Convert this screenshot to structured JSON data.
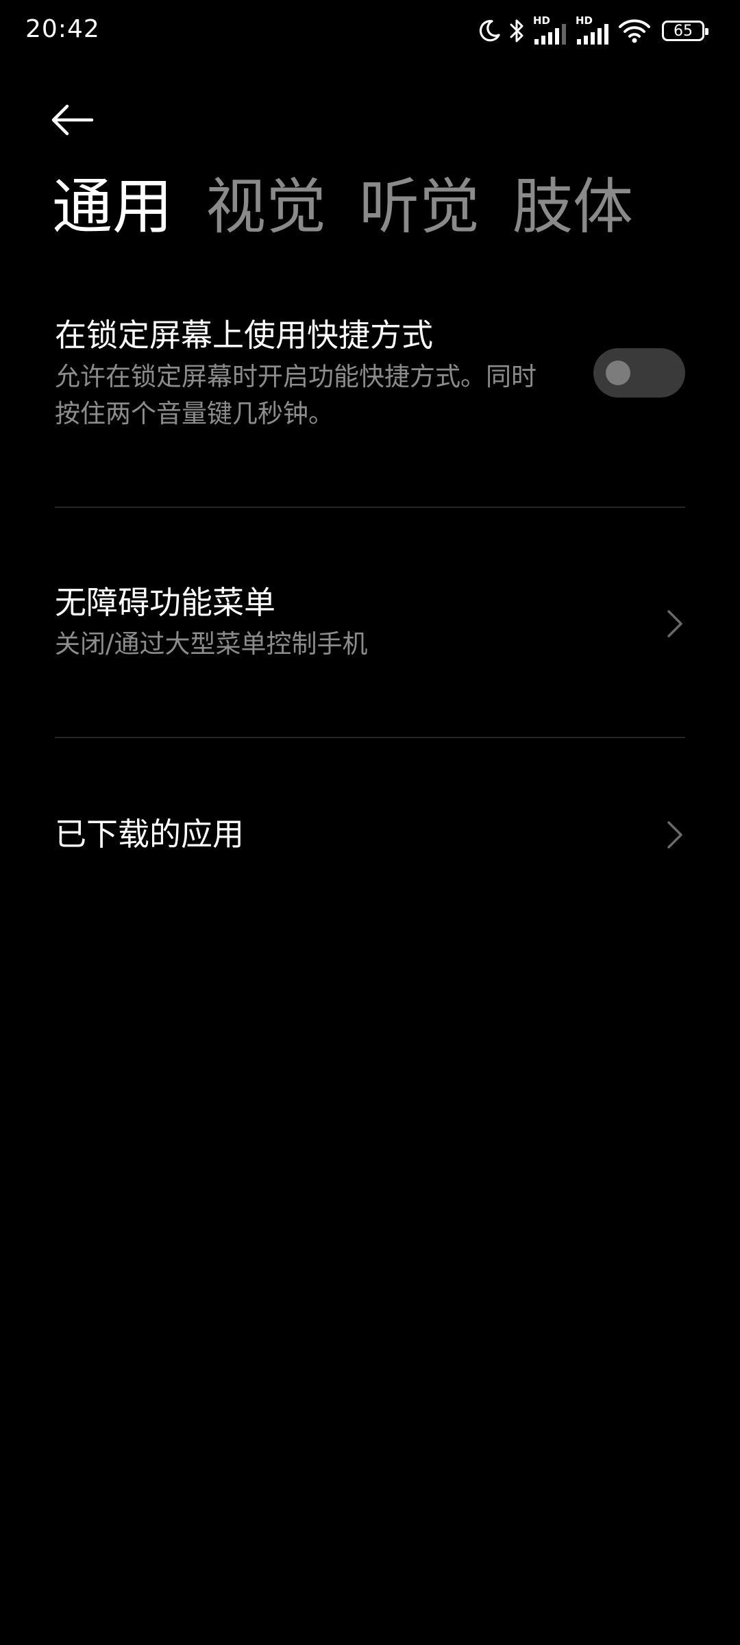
{
  "status_bar": {
    "time": "20:42",
    "hd1": "HD",
    "hd2": "HD",
    "battery": "65"
  },
  "header": {
    "back_icon": "arrow-left-icon"
  },
  "tabs": [
    {
      "label": "通用",
      "active": true
    },
    {
      "label": "视觉",
      "active": false
    },
    {
      "label": "听觉",
      "active": false
    },
    {
      "label": "肢体",
      "active": false
    }
  ],
  "settings": {
    "lock_screen_shortcut": {
      "title": "在锁定屏幕上使用快捷方式",
      "desc_line1": "允许在锁定屏幕时开启功能快捷方式。同时",
      "desc_line2": "按住两个音量键几秒钟。",
      "enabled": false
    },
    "accessibility_menu": {
      "title": "无障碍功能菜单",
      "desc": "关闭/通过大型菜单控制手机"
    },
    "downloaded_apps": {
      "title": "已下载的应用"
    }
  },
  "colors": {
    "background": "#000000",
    "text_primary": "#ffffff",
    "text_secondary": "#8c8c8c",
    "toggle_track": "#3a3a3a",
    "toggle_knob": "#7c7c7c"
  }
}
